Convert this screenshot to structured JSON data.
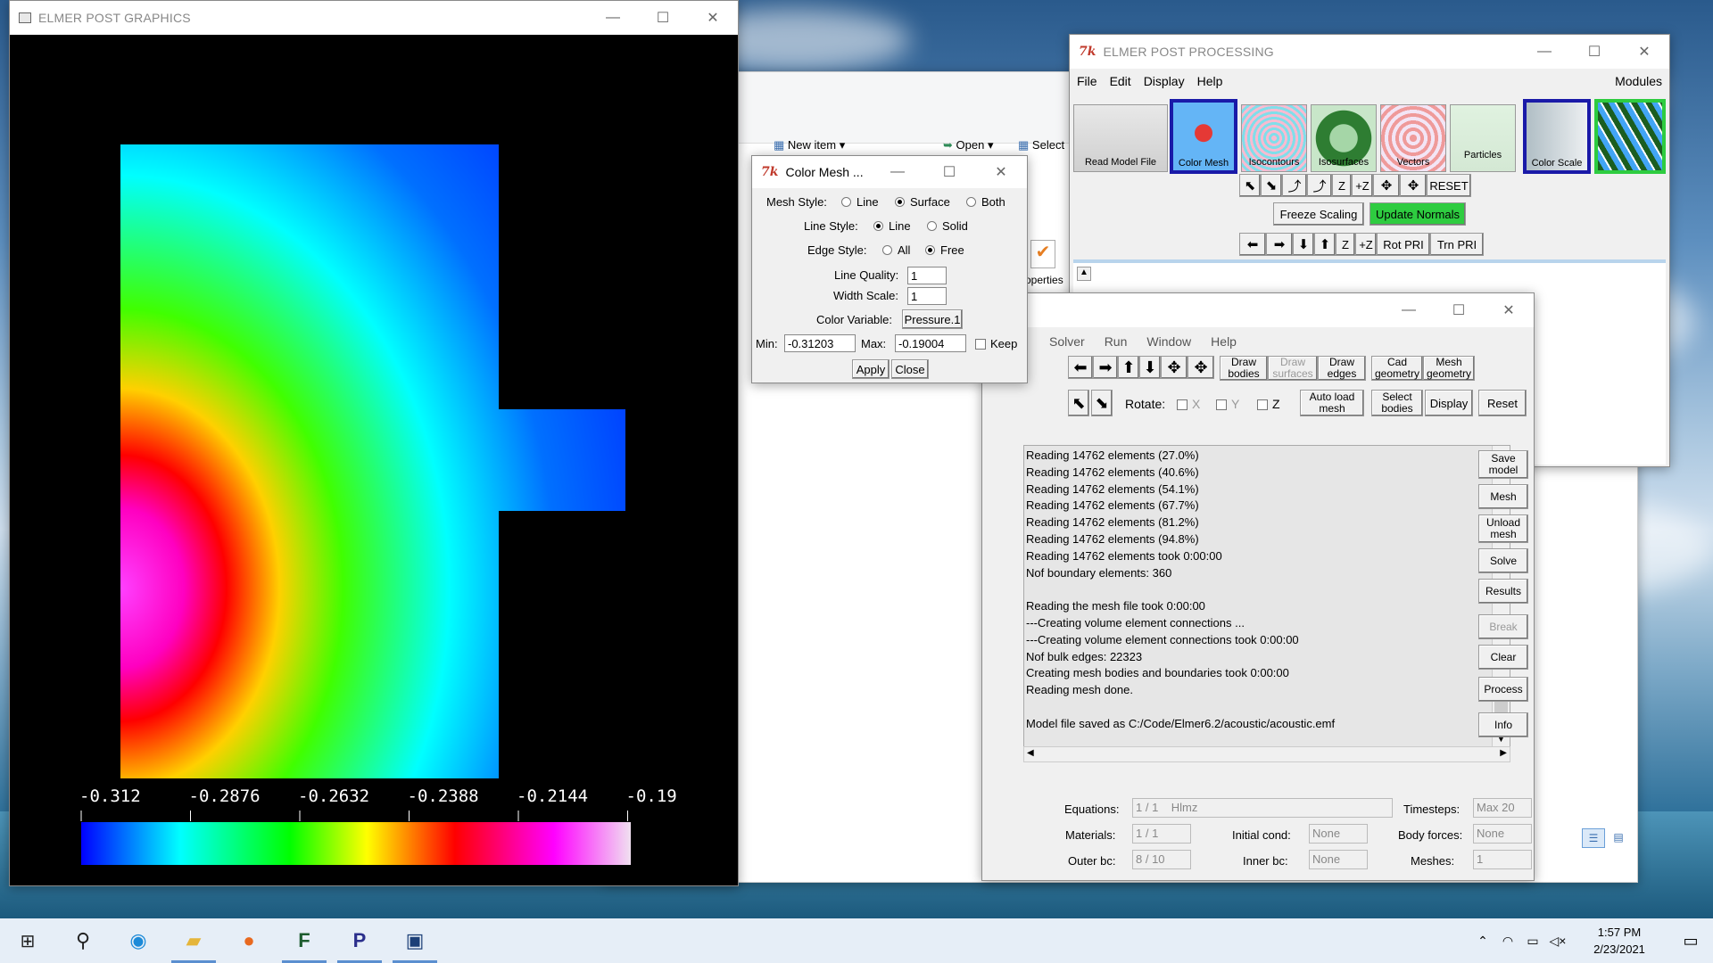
{
  "graphics": {
    "title": "ELMER POST GRAPHICS",
    "colorbar_ticks": [
      "-0.312",
      "-0.2876",
      "-0.2632",
      "-0.2388",
      "-0.2144",
      "-0.19"
    ]
  },
  "explorer": {
    "new_item": "New item",
    "open": "Open",
    "select": "Select",
    "properties": "operties"
  },
  "colormesh": {
    "title": "Color Mesh ...",
    "mesh_style_label": "Mesh Style:",
    "mesh_opt_line": "Line",
    "mesh_opt_surface": "Surface",
    "mesh_opt_both": "Both",
    "line_style_label": "Line Style:",
    "line_opt_line": "Line",
    "line_opt_solid": "Solid",
    "edge_style_label": "Edge Style:",
    "edge_opt_all": "All",
    "edge_opt_free": "Free",
    "line_quality_label": "Line Quality:",
    "line_quality_value": "1",
    "width_scale_label": "Width Scale:",
    "width_scale_value": "1",
    "color_variable_label": "Color Variable:",
    "color_variable_value": "Pressure.1",
    "min_label": "Min:",
    "min_value": "-0.31203",
    "max_label": "Max:",
    "max_value": "-0.19004",
    "keep_label": "Keep",
    "apply": "Apply",
    "close": "Close"
  },
  "post": {
    "title": "ELMER POST PROCESSING",
    "menu": [
      "File",
      "Edit",
      "Display",
      "Help"
    ],
    "modules": "Modules",
    "icons": [
      "Read Model File",
      "Color Mesh",
      "Isocontours",
      "Isosurfaces",
      "Vectors",
      "Particles",
      "Color Scale"
    ],
    "reset": "RESET",
    "freeze_scaling": "Freeze Scaling",
    "update_normals": "Update Normals",
    "rot_pri": "Rot PRI",
    "trn_pri": "Trn PRI",
    "z_minus": "Z",
    "z_plus": "+Z"
  },
  "gui": {
    "menu": [
      "Solver",
      "Run",
      "Window",
      "Help"
    ],
    "draw_bodies": "Draw bodies",
    "draw_surfaces": "Draw surfaces",
    "draw_edges": "Draw edges",
    "cad_geometry": "Cad geometry",
    "mesh_geometry": "Mesh geometry",
    "rotate_label": "Rotate:",
    "x": "X",
    "y": "Y",
    "z": "Z",
    "auto_load_mesh": "Auto load mesh",
    "select_bodies": "Select bodies",
    "display": "Display",
    "reset": "Reset",
    "side_buttons": [
      "Save model",
      "Mesh",
      "Unload mesh",
      "Solve",
      "Results",
      "Break",
      "Clear",
      "Process",
      "Info"
    ],
    "log": [
      "Reading 14762 elements (27.0%)",
      "Reading 14762 elements (40.6%)",
      "Reading 14762 elements (54.1%)",
      "Reading 14762 elements (67.7%)",
      "Reading 14762 elements (81.2%)",
      "Reading 14762 elements (94.8%)",
      "Reading 14762 elements took 0:00:00",
      "Nof boundary elements: 360",
      "",
      "Reading the mesh file took 0:00:00",
      "---Creating volume element connections ...",
      "---Creating volume element connections took 0:00:00",
      "Nof bulk edges: 22323",
      "Creating mesh bodies and boundaries took 0:00:00",
      "Reading mesh done.",
      "",
      "Model file saved as C:/Code/Elmer6.2/acoustic/acoustic.emf"
    ],
    "equations_label": "Equations:",
    "equations_count": "1 / 1",
    "equations_value": "Hlmz",
    "timesteps_label": "Timesteps:",
    "timesteps_value": "Max 20",
    "materials_label": "Materials:",
    "materials_value": "1 / 1",
    "initial_cond_label": "Initial cond:",
    "initial_cond_value": "None",
    "body_forces_label": "Body forces:",
    "body_forces_value": "None",
    "outer_bc_label": "Outer bc:",
    "outer_bc_value": "8 / 10",
    "inner_bc_label": "Inner bc:",
    "inner_bc_value": "None",
    "meshes_label": "Meshes:",
    "meshes_value": "1"
  },
  "taskbar": {
    "time": "1:57 PM",
    "date": "2/23/2021"
  }
}
